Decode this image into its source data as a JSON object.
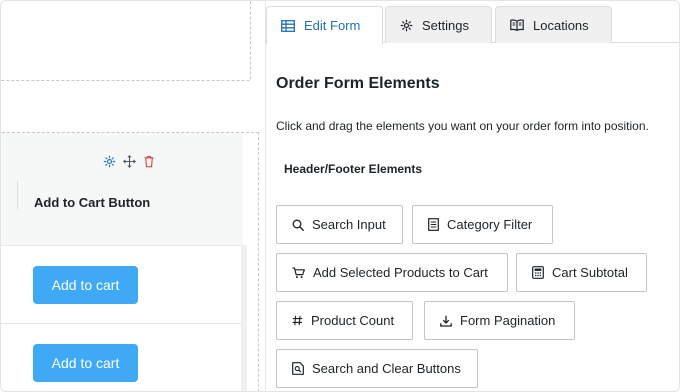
{
  "left": {
    "column_title": "Add to Cart Button",
    "cart_buttons": [
      "Add to cart",
      "Add to cart"
    ],
    "column_icons": [
      "gear-icon",
      "move-icon",
      "trash-icon"
    ]
  },
  "tabs": [
    {
      "label": "Edit Form",
      "icon": "table-icon",
      "active": true
    },
    {
      "label": "Settings",
      "icon": "gear-icon",
      "active": false
    },
    {
      "label": "Locations",
      "icon": "book-icon",
      "active": false
    }
  ],
  "panel": {
    "title": "Order Form Elements",
    "description": "Click and drag the elements you want on your order form into position.",
    "section_title": "Header/Footer Elements",
    "elements": [
      {
        "label": "Search Input",
        "icon": "search-icon"
      },
      {
        "label": "Category Filter",
        "icon": "list-icon"
      },
      {
        "label": "Add Selected Products to Cart",
        "icon": "cart-icon"
      },
      {
        "label": "Cart Subtotal",
        "icon": "calculator-icon"
      },
      {
        "label": "Product Count",
        "icon": "hash-icon"
      },
      {
        "label": "Form Pagination",
        "icon": "download-icon"
      },
      {
        "label": "Search and Clear Buttons",
        "icon": "search-page-icon"
      }
    ]
  },
  "colors": {
    "accent": "#2271b1",
    "cart_button": "#3fa9f5",
    "delete": "#d63638",
    "settings_icon": "#2271b1"
  }
}
